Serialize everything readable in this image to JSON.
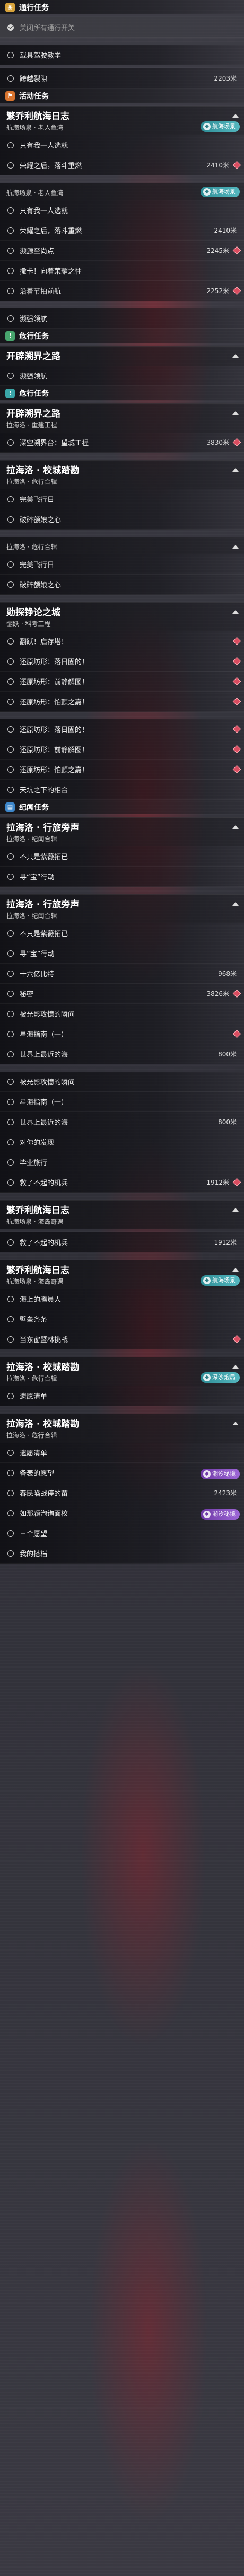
{
  "sections": [
    {
      "type": "category",
      "label": "通行任务",
      "icon": "compass-icon",
      "color": "yellow"
    },
    {
      "type": "task",
      "label": "关闭所有通行开关",
      "checked": true,
      "highlight": true
    },
    {
      "type": "gap"
    },
    {
      "type": "task",
      "label": "载具驾驶教学",
      "checked": false
    },
    {
      "type": "gap-sm"
    },
    {
      "type": "task",
      "label": "跨越裂隙",
      "checked": false,
      "distance": "2203米"
    },
    {
      "type": "category",
      "label": "活动任务",
      "icon": "flag-icon",
      "color": "orange"
    },
    {
      "type": "group",
      "title": "繁乔利航海日志",
      "subtitle": "航海场泉 · 老人鱼湾",
      "badge": "航海场景",
      "badge_style": "teal"
    },
    {
      "type": "task",
      "label": "只有我一人选就",
      "checked": false
    },
    {
      "type": "task",
      "label": "荣耀之后，落斗重燃",
      "checked": false,
      "distance": "2410米",
      "marker": true
    },
    {
      "type": "gap"
    },
    {
      "type": "group",
      "title": "",
      "subtitle": "航海场泉 · 老人鱼湾",
      "badge": "航海场景",
      "badge_style": "teal"
    },
    {
      "type": "task",
      "label": "只有我一人选就",
      "checked": false
    },
    {
      "type": "task",
      "label": "荣耀之后，落斗重燃",
      "checked": false,
      "distance": "2410米"
    },
    {
      "type": "task",
      "label": "濒源至尚点",
      "checked": false,
      "distance": "2245米",
      "marker": true
    },
    {
      "type": "task",
      "label": "撒卡！向着荣耀之往",
      "checked": false
    },
    {
      "type": "task",
      "label": "沿着节拍前航",
      "checked": false,
      "distance": "2252米",
      "marker": true
    },
    {
      "type": "gap"
    },
    {
      "type": "task",
      "label": "濒强领航",
      "checked": false
    },
    {
      "type": "category",
      "label": "危行任务",
      "icon": "warning-icon",
      "color": "green"
    },
    {
      "type": "group",
      "title": "开辟溯界之路",
      "subtitle": "",
      "badge": "",
      "badge_style": ""
    },
    {
      "type": "task",
      "label": "濒强领航",
      "checked": false
    },
    {
      "type": "category",
      "label": "危行任务",
      "icon": "warning-icon",
      "color": "teal"
    },
    {
      "type": "group",
      "title": "开辟溯界之路",
      "subtitle": "拉海洛 · 重建工程",
      "badge": "",
      "badge_style": ""
    },
    {
      "type": "task",
      "label": "深空溯界台：望城工程",
      "checked": false,
      "distance": "3830米",
      "marker": true
    },
    {
      "type": "gap"
    },
    {
      "type": "group",
      "title": "拉海洛 · 校城踏勘",
      "subtitle": "拉海洛 · 危行合辑",
      "badge": "",
      "badge_style": ""
    },
    {
      "type": "task",
      "label": "完美飞行日",
      "checked": false
    },
    {
      "type": "task",
      "label": "破碎额娘之心",
      "checked": false
    },
    {
      "type": "gap"
    },
    {
      "type": "group",
      "title": "",
      "subtitle": "拉海洛 · 危行合辑",
      "badge": "",
      "badge_style": ""
    },
    {
      "type": "task",
      "label": "完美飞行日",
      "checked": false
    },
    {
      "type": "task",
      "label": "破碎额娘之心",
      "checked": false
    },
    {
      "type": "gap"
    },
    {
      "type": "group",
      "title": "勋探铮论之城",
      "subtitle": "翻跃 · 科考工程",
      "badge": "",
      "badge_style": ""
    },
    {
      "type": "task",
      "label": "翻跃！启存塔！",
      "checked": false,
      "marker": true
    },
    {
      "type": "task",
      "label": "还原坊形：落日固的！",
      "checked": false,
      "marker": true
    },
    {
      "type": "task",
      "label": "还原坊形：前静解图！",
      "checked": false,
      "marker": true
    },
    {
      "type": "task",
      "label": "还原坊形：怕颤之嘉！",
      "checked": false,
      "marker": true
    },
    {
      "type": "gap"
    },
    {
      "type": "task",
      "label": "还原坊形：落日固的！",
      "checked": false,
      "marker": true
    },
    {
      "type": "task",
      "label": "还原坊形：前静解图！",
      "checked": false,
      "marker": true
    },
    {
      "type": "task",
      "label": "还原坊形：怕颤之嘉！",
      "checked": false,
      "marker": true
    },
    {
      "type": "task",
      "label": "天坑之下的相合",
      "checked": false
    },
    {
      "type": "category",
      "label": "纪闻任务",
      "icon": "book-icon",
      "color": "blue"
    },
    {
      "type": "group",
      "title": "拉海洛 · 行旅旁声",
      "subtitle": "拉海洛 · 纪闻合辑",
      "badge": "",
      "badge_style": ""
    },
    {
      "type": "task",
      "label": "不只是紫薇拓已",
      "checked": false
    },
    {
      "type": "task",
      "label": "寻“宝”行动",
      "checked": false
    },
    {
      "type": "gap"
    },
    {
      "type": "group",
      "title": "拉海洛 · 行旅旁声",
      "subtitle": "拉海洛 · 纪闻合辑",
      "badge": "",
      "badge_style": ""
    },
    {
      "type": "task",
      "label": "不只是紫薇拓已",
      "checked": false
    },
    {
      "type": "task",
      "label": "寻“宝”行动",
      "checked": false
    },
    {
      "type": "task",
      "label": "十六亿比特",
      "checked": false,
      "distance": "968米"
    },
    {
      "type": "task",
      "label": "秘密",
      "checked": false,
      "distance": "3826米",
      "marker": true
    },
    {
      "type": "task",
      "label": "被光影攻憶的瞬间",
      "checked": false
    },
    {
      "type": "task",
      "label": "星海指南（一）",
      "checked": false,
      "marker": true
    },
    {
      "type": "task",
      "label": "世界上最近的海",
      "checked": false,
      "distance": "800米"
    },
    {
      "type": "gap"
    },
    {
      "type": "task",
      "label": "被光影攻憶的瞬间",
      "checked": false
    },
    {
      "type": "task",
      "label": "星海指南（一）",
      "checked": false
    },
    {
      "type": "task",
      "label": "世界上最近的海",
      "checked": false,
      "distance": "800米"
    },
    {
      "type": "task",
      "label": "对你的发现",
      "checked": false
    },
    {
      "type": "task",
      "label": "毕业旅行",
      "checked": false
    },
    {
      "type": "task",
      "label": "救了不起的机兵",
      "checked": false,
      "distance": "1912米",
      "marker": true
    },
    {
      "type": "gap"
    },
    {
      "type": "group",
      "title": "繁乔利航海日志",
      "subtitle": "航海场泉 · 海岛奇遇",
      "badge": "",
      "badge_style": ""
    },
    {
      "type": "gap-sm"
    },
    {
      "type": "task",
      "label": "救了不起的机兵",
      "checked": false,
      "distance": "1912米"
    },
    {
      "type": "gap"
    },
    {
      "type": "group",
      "title": "繁乔利航海日志",
      "subtitle": "航海场泉 · 海岛奇遇",
      "badge": "航海场景",
      "badge_style": "teal"
    },
    {
      "type": "task",
      "label": "海上的腾員人",
      "checked": false
    },
    {
      "type": "task",
      "label": "壁垒条条",
      "checked": false
    },
    {
      "type": "task",
      "label": "当东窗暨林挑战",
      "checked": false,
      "marker": true
    },
    {
      "type": "gap"
    },
    {
      "type": "group",
      "title": "拉海洛 · 校城踏勘",
      "subtitle": "拉海洛 · 危行合辑",
      "badge": "深沙炮局",
      "badge_style": "teal"
    },
    {
      "type": "task",
      "label": "遗愿清单",
      "checked": false
    },
    {
      "type": "gap"
    },
    {
      "type": "group",
      "title": "拉海洛 · 校城踏勘",
      "subtitle": "拉海洛 · 危行合辑",
      "badge": "",
      "badge_style": ""
    },
    {
      "type": "task",
      "label": "遗愿清单",
      "checked": false
    },
    {
      "type": "task",
      "label": "备表的愿望",
      "checked": false,
      "badge": "潮汐秘境",
      "badge_style": "purple"
    },
    {
      "type": "task",
      "label": "春民陷战停的苗",
      "checked": false,
      "distance": "2423米"
    },
    {
      "type": "task",
      "label": "如那颖泡询面校",
      "checked": false,
      "badge": "潮汐秘境",
      "badge_style": "purple"
    },
    {
      "type": "task",
      "label": "三个愿望",
      "checked": false
    },
    {
      "type": "task",
      "label": "我的搭档",
      "checked": false
    }
  ]
}
